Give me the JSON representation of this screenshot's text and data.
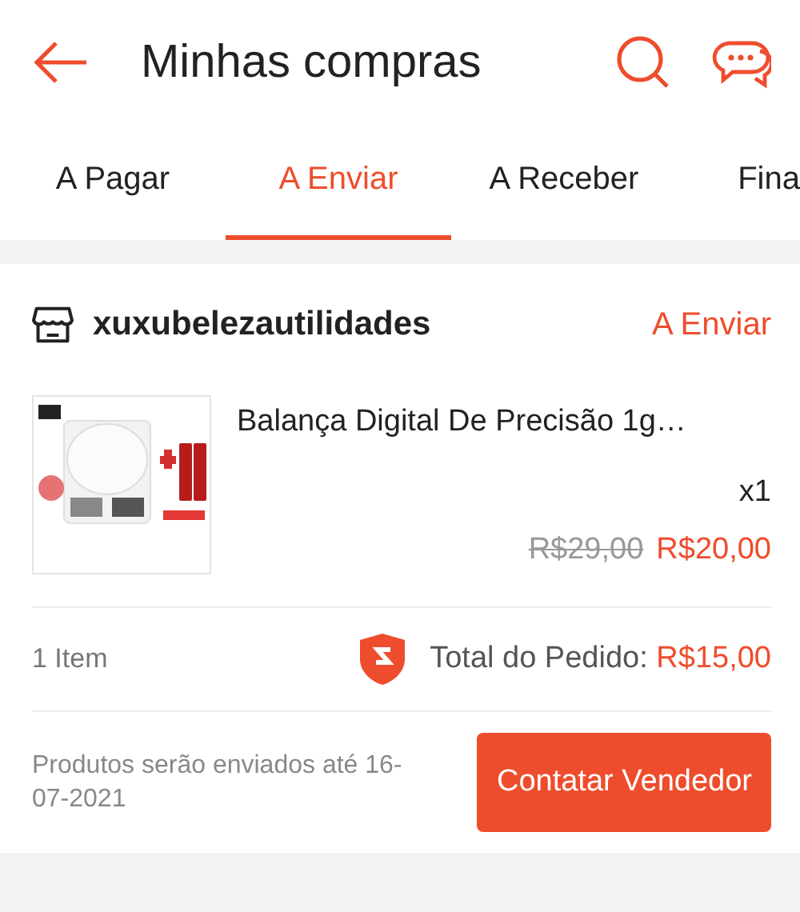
{
  "header": {
    "title": "Minhas compras"
  },
  "tabs": [
    {
      "label": "A Pagar",
      "selected": false
    },
    {
      "label": "A Enviar",
      "selected": true
    },
    {
      "label": "A Receber",
      "selected": false
    },
    {
      "label": "Fina",
      "selected": false
    }
  ],
  "order": {
    "shop": "xuxubelezautilidades",
    "status": "A Enviar",
    "product": {
      "name": "Balança Digital De Precisão 1g…",
      "quantity": "x1",
      "old_price": "R$29,00",
      "price": "R$20,00"
    },
    "item_count": "1 Item",
    "total_label": "Total do Pedido:",
    "total": "R$15,00",
    "shipping_note": "Produtos serão enviados até 16-07-2021",
    "button": "Contatar Vendedor"
  }
}
